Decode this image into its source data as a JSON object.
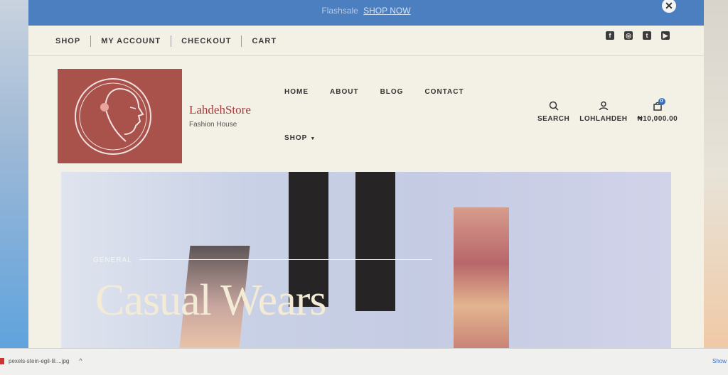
{
  "flash": {
    "text": "Flashsale",
    "link": "SHOP NOW",
    "close": "✕"
  },
  "topnav": [
    "SHOP",
    "MY ACCOUNT",
    "CHECKOUT",
    "CART"
  ],
  "social": [
    {
      "name": "facebook-icon",
      "glyph": "f"
    },
    {
      "name": "instagram-icon",
      "glyph": "◎"
    },
    {
      "name": "twitter-icon",
      "glyph": "t"
    },
    {
      "name": "youtube-icon",
      "glyph": "▶"
    }
  ],
  "brand": {
    "name": "LahdehStore",
    "tagline": "Fashion House",
    "logo_color": "#a9524c"
  },
  "mainnav": {
    "row1": [
      "HOME",
      "ABOUT",
      "BLOG",
      "CONTACT"
    ],
    "row2": "SHOP"
  },
  "tools": {
    "search": "SEARCH",
    "account": "LOHLAHDEH",
    "cart_total": "₦10,000.00",
    "cart_count": "0"
  },
  "hero": {
    "category": "GENERAL",
    "title": "Casual Wears"
  },
  "download": {
    "filename": "pexels-stein-egil-lil....jpg",
    "show": "Show"
  },
  "colors": {
    "flash_bar": "#4c7fbf",
    "page_bg": "#f3f0e6",
    "accent": "#a53b3b"
  }
}
